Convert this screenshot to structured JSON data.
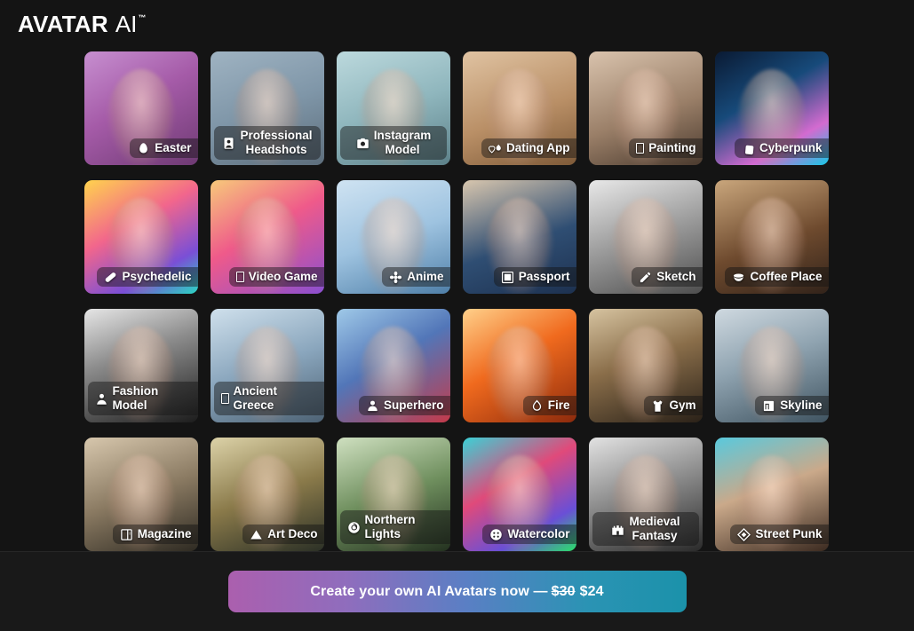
{
  "header": {
    "logo_primary": "AVATAR",
    "logo_secondary": "AI",
    "logo_trademark": "™"
  },
  "gallery": {
    "cards": [
      {
        "label": "Easter",
        "icon": "easter-egg-icon",
        "two_line": false
      },
      {
        "label": "Professional\nHeadshots",
        "icon": "portrait-frame-icon",
        "two_line": true
      },
      {
        "label": "Instagram\nModel",
        "icon": "camera-icon",
        "two_line": true
      },
      {
        "label": "Dating App",
        "icon": "heart-flame-icon",
        "two_line": false
      },
      {
        "label": "Painting",
        "icon": "missing-glyph-icon",
        "two_line": false
      },
      {
        "label": "Cyberpunk",
        "icon": "tag-icon",
        "two_line": false
      },
      {
        "label": "Psychedelic",
        "icon": "pill-icon",
        "two_line": false
      },
      {
        "label": "Video Game",
        "icon": "missing-glyph-icon",
        "two_line": false
      },
      {
        "label": "Anime",
        "icon": "flower-icon",
        "two_line": false
      },
      {
        "label": "Passport",
        "icon": "id-card-icon",
        "two_line": false
      },
      {
        "label": "Sketch",
        "icon": "pencil-icon",
        "two_line": false
      },
      {
        "label": "Coffee Place",
        "icon": "coffee-cup-icon",
        "two_line": false
      },
      {
        "label": "Fashion Model",
        "icon": "person-icon",
        "two_line": false
      },
      {
        "label": "Ancient Greece",
        "icon": "missing-glyph-icon",
        "two_line": false
      },
      {
        "label": "Superhero",
        "icon": "hero-person-icon",
        "two_line": false
      },
      {
        "label": "Fire",
        "icon": "flame-icon",
        "two_line": false
      },
      {
        "label": "Gym",
        "icon": "tank-top-icon",
        "two_line": false
      },
      {
        "label": "Skyline",
        "icon": "window-icon",
        "two_line": false
      },
      {
        "label": "Magazine",
        "icon": "book-icon",
        "two_line": false
      },
      {
        "label": "Art Deco",
        "icon": "triangle-icon",
        "two_line": false
      },
      {
        "label": "Northern Lights",
        "icon": "spiral-icon",
        "two_line": false
      },
      {
        "label": "Watercolor",
        "icon": "palette-icon",
        "two_line": false
      },
      {
        "label": "Medieval\nFantasy",
        "icon": "castle-icon",
        "two_line": true
      },
      {
        "label": "Street Punk",
        "icon": "diamond-icon",
        "two_line": false
      }
    ]
  },
  "footer": {
    "cta_prefix": "Create your own AI Avatars now — ",
    "cta_old_price": "$30",
    "cta_new_price": "$24"
  },
  "colors": {
    "background": "#141414",
    "footer_background": "#191919",
    "cta_gradient_start": "#ab5fae",
    "cta_gradient_mid": "#5a7fc4",
    "cta_gradient_end": "#1b92aa",
    "text": "#ffffff"
  }
}
